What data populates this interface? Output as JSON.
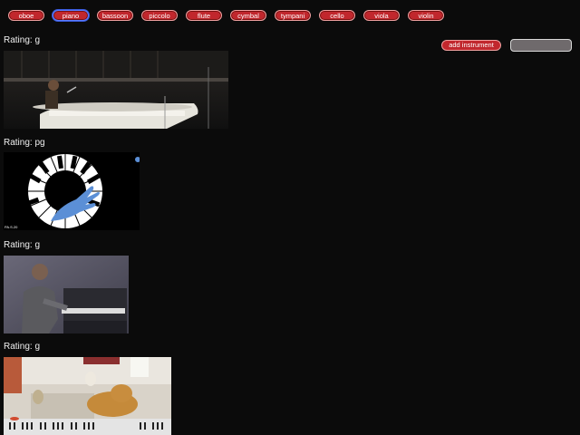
{
  "instruments": [
    {
      "label": "oboe",
      "selected": false
    },
    {
      "label": "piano",
      "selected": true
    },
    {
      "label": "bassoon",
      "selected": false
    },
    {
      "label": "piccolo",
      "selected": false
    },
    {
      "label": "flute",
      "selected": false
    },
    {
      "label": "cymbal",
      "selected": false
    },
    {
      "label": "tympani",
      "selected": false
    },
    {
      "label": "cello",
      "selected": false
    },
    {
      "label": "viola",
      "selected": false
    },
    {
      "label": "violin",
      "selected": false
    }
  ],
  "add": {
    "button_label": "add instrument",
    "input_value": "",
    "input_placeholder": ""
  },
  "results": [
    {
      "rating_label": "Rating: g",
      "image": "man-singing-at-white-grand-piano"
    },
    {
      "rating_label": "Rating: pg",
      "image": "piano-keyboard-ring-with-blue-hand-logo",
      "logo_caption": "PA.S.20"
    },
    {
      "rating_label": "Rating: g",
      "image": "man-playing-upright-piano"
    },
    {
      "rating_label": "Rating: g",
      "image": "dogs-playing-keyboard"
    }
  ],
  "colors": {
    "background": "#0b0b0b",
    "button": "#c1272d",
    "selected_outline": "#3b5bdb",
    "input": "#6f6a6c"
  }
}
